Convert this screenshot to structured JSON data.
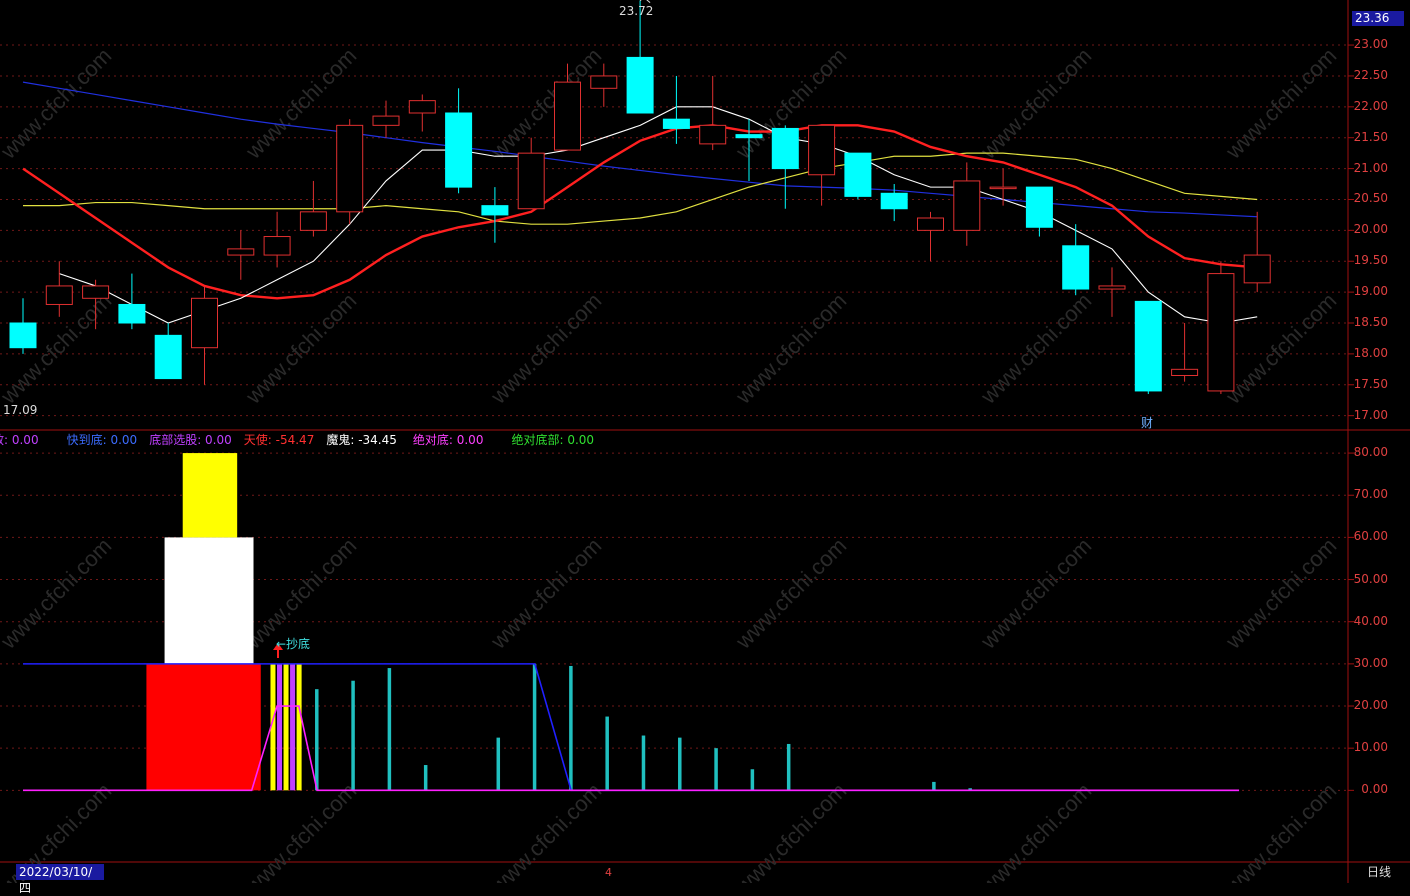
{
  "header": {
    "last_price": "23.36",
    "high_label": "23.72",
    "low_label": "17.09"
  },
  "price_axis": [
    "23.00",
    "22.50",
    "22.00",
    "21.50",
    "21.00",
    "20.50",
    "20.00",
    "19.50",
    "19.00",
    "18.50",
    "18.00",
    "17.50",
    "17.00"
  ],
  "indicator_axis": [
    "80.00",
    "70.00",
    "60.00",
    "50.00",
    "40.00",
    "30.00",
    "20.00",
    "10.00",
    "0.00"
  ],
  "indicator_bar": [
    {
      "label": "散:",
      "value": "0.00",
      "color": "#c040ff"
    },
    {
      "label": "快到底:",
      "value": "0.00",
      "color": "#3c6cff"
    },
    {
      "label": "底部选股:",
      "value": "0.00",
      "color": "#c040ff"
    },
    {
      "label": "天使:",
      "value": "-54.47",
      "color": "#ff3030"
    },
    {
      "label": "魔鬼:",
      "value": "-34.45",
      "color": "#ffffff"
    },
    {
      "label": "绝对底:",
      "value": "0.00",
      "color": "#ff40ff"
    },
    {
      "label": "绝对底部:",
      "value": "0.00",
      "color": "#30e030"
    }
  ],
  "annotations": {
    "chaodi": "←抄底",
    "cai": "财",
    "month": "4"
  },
  "footer": {
    "date": "2022/03/10/四",
    "period": "日线"
  },
  "watermark": "www.cfchi.com",
  "colors": {
    "up": "#e03030",
    "down": "#00ffff",
    "ma5": "#ffffff",
    "ma10": "#ff2020",
    "ma20": "#e0e040",
    "ma60": "#2030e0"
  },
  "chart_data": {
    "type": "candlestick",
    "ylim": [
      16.8,
      23.6
    ],
    "candles": [
      {
        "o": 18.5,
        "c": 18.1,
        "h": 18.9,
        "l": 18.0
      },
      {
        "o": 18.8,
        "c": 19.1,
        "h": 19.5,
        "l": 18.6
      },
      {
        "o": 18.9,
        "c": 19.1,
        "h": 19.2,
        "l": 18.4
      },
      {
        "o": 18.8,
        "c": 18.5,
        "h": 19.3,
        "l": 18.4
      },
      {
        "o": 18.3,
        "c": 17.6,
        "h": 18.5,
        "l": 17.6
      },
      {
        "o": 18.1,
        "c": 18.9,
        "h": 19.1,
        "l": 17.5
      },
      {
        "o": 19.6,
        "c": 19.7,
        "h": 20.0,
        "l": 19.2
      },
      {
        "o": 19.6,
        "c": 19.9,
        "h": 20.3,
        "l": 19.4
      },
      {
        "o": 20.0,
        "c": 20.3,
        "h": 20.8,
        "l": 19.9
      },
      {
        "o": 20.3,
        "c": 21.7,
        "h": 21.8,
        "l": 20.1
      },
      {
        "o": 21.7,
        "c": 21.85,
        "h": 22.1,
        "l": 21.5
      },
      {
        "o": 21.9,
        "c": 22.1,
        "h": 22.2,
        "l": 21.6
      },
      {
        "o": 21.9,
        "c": 20.7,
        "h": 22.3,
        "l": 20.6
      },
      {
        "o": 20.4,
        "c": 20.25,
        "h": 20.7,
        "l": 19.8
      },
      {
        "o": 20.35,
        "c": 21.25,
        "h": 21.5,
        "l": 20.35
      },
      {
        "o": 21.3,
        "c": 22.4,
        "h": 22.7,
        "l": 21.3
      },
      {
        "o": 22.3,
        "c": 22.5,
        "h": 22.7,
        "l": 22.0
      },
      {
        "o": 22.8,
        "c": 21.9,
        "h": 23.72,
        "l": 21.9
      },
      {
        "o": 21.8,
        "c": 21.65,
        "h": 22.5,
        "l": 21.4
      },
      {
        "o": 21.4,
        "c": 21.7,
        "h": 22.5,
        "l": 21.3
      },
      {
        "o": 21.55,
        "c": 21.5,
        "h": 21.8,
        "l": 20.8
      },
      {
        "o": 21.65,
        "c": 21.0,
        "h": 21.7,
        "l": 20.35
      },
      {
        "o": 20.9,
        "c": 21.7,
        "h": 21.7,
        "l": 20.4
      },
      {
        "o": 21.25,
        "c": 20.55,
        "h": 21.25,
        "l": 20.5
      },
      {
        "o": 20.6,
        "c": 20.35,
        "h": 20.75,
        "l": 20.15
      },
      {
        "o": 20.0,
        "c": 20.2,
        "h": 20.3,
        "l": 19.5
      },
      {
        "o": 20.0,
        "c": 20.8,
        "h": 21.1,
        "l": 19.75
      },
      {
        "o": 20.7,
        "c": 20.7,
        "h": 21.0,
        "l": 20.4
      },
      {
        "o": 20.7,
        "c": 20.05,
        "h": 20.7,
        "l": 19.9
      },
      {
        "o": 19.75,
        "c": 19.05,
        "h": 20.1,
        "l": 18.95
      },
      {
        "o": 19.05,
        "c": 19.1,
        "h": 19.4,
        "l": 18.6
      },
      {
        "o": 18.85,
        "c": 17.4,
        "h": 18.85,
        "l": 17.35
      },
      {
        "o": 17.65,
        "c": 17.75,
        "h": 18.5,
        "l": 17.55
      },
      {
        "o": 17.4,
        "c": 19.3,
        "h": 19.5,
        "l": 17.35
      },
      {
        "o": 19.15,
        "c": 19.6,
        "h": 20.3,
        "l": 19.0
      }
    ],
    "ma5": [
      null,
      19.3,
      19.1,
      18.8,
      18.5,
      18.7,
      18.9,
      19.2,
      19.5,
      20.1,
      20.8,
      21.3,
      21.3,
      21.2,
      21.2,
      21.3,
      21.5,
      21.7,
      22.0,
      22.0,
      21.8,
      21.5,
      21.4,
      21.2,
      20.9,
      20.7,
      20.7,
      20.5,
      20.3,
      20.0,
      19.7,
      19.0,
      18.6,
      18.5,
      18.6
    ],
    "ma10": [
      21.0,
      20.6,
      20.2,
      19.8,
      19.4,
      19.1,
      18.95,
      18.9,
      18.95,
      19.2,
      19.6,
      19.9,
      20.05,
      20.15,
      20.3,
      20.7,
      21.1,
      21.45,
      21.65,
      21.7,
      21.6,
      21.6,
      21.7,
      21.7,
      21.6,
      21.35,
      21.2,
      21.1,
      20.9,
      20.7,
      20.4,
      19.9,
      19.55,
      19.45,
      19.4
    ],
    "ma20": [
      20.4,
      20.4,
      20.45,
      20.45,
      20.4,
      20.35,
      20.35,
      20.35,
      20.35,
      20.35,
      20.4,
      20.35,
      20.3,
      20.15,
      20.1,
      20.1,
      20.15,
      20.2,
      20.3,
      20.5,
      20.7,
      20.85,
      21.0,
      21.1,
      21.2,
      21.2,
      21.25,
      21.25,
      21.2,
      21.15,
      21.0,
      20.8,
      20.6,
      20.55,
      20.5
    ],
    "ma60": [
      22.4,
      22.3,
      22.2,
      22.1,
      22.0,
      21.9,
      21.8,
      21.72,
      21.65,
      21.58,
      21.5,
      21.42,
      21.35,
      21.28,
      21.2,
      21.12,
      21.04,
      20.97,
      20.9,
      20.84,
      20.78,
      20.72,
      20.7,
      20.68,
      20.65,
      20.6,
      20.55,
      20.5,
      20.45,
      20.4,
      20.35,
      20.3,
      20.28,
      20.25,
      20.22
    ],
    "indicator": {
      "ylim": [
        -17,
        85
      ],
      "red_block": {
        "x0": 3.4,
        "x1": 6.55,
        "bottom": 0,
        "top": 30
      },
      "white_block": {
        "x0": 3.9,
        "x1": 6.35,
        "bottom": 30,
        "top": 60
      },
      "yellow_block": {
        "x0": 4.4,
        "x1": 5.9,
        "bottom": 60,
        "top": 80
      },
      "stripes": [
        {
          "i": 6.9,
          "color": "#ffff00"
        },
        {
          "i": 7.08,
          "color": "#c040ff"
        },
        {
          "i": 7.26,
          "color": "#ffff00"
        },
        {
          "i": 7.44,
          "color": "#c040ff"
        },
        {
          "i": 7.62,
          "color": "#ffff00"
        }
      ],
      "cyan_bars": [
        [
          8.1,
          24
        ],
        [
          9.1,
          26
        ],
        [
          10.1,
          29
        ],
        [
          11.1,
          6
        ],
        [
          13.1,
          12.5
        ],
        [
          14.1,
          30
        ],
        [
          15.1,
          29.5
        ],
        [
          16.1,
          17.5
        ],
        [
          17.1,
          13
        ],
        [
          18.1,
          12.5
        ],
        [
          19.1,
          10
        ],
        [
          20.1,
          5
        ],
        [
          21.1,
          11
        ],
        [
          25.1,
          2
        ],
        [
          26.1,
          0.5
        ]
      ],
      "blue_line": [
        [
          0,
          30
        ],
        [
          14.1,
          30
        ],
        [
          15.1,
          0
        ],
        [
          33.5,
          0
        ]
      ],
      "magenta_line": [
        [
          0,
          0
        ],
        [
          6.3,
          0
        ],
        [
          7.0,
          20
        ],
        [
          7.6,
          20
        ],
        [
          8.1,
          0
        ],
        [
          33.5,
          0
        ]
      ]
    }
  }
}
